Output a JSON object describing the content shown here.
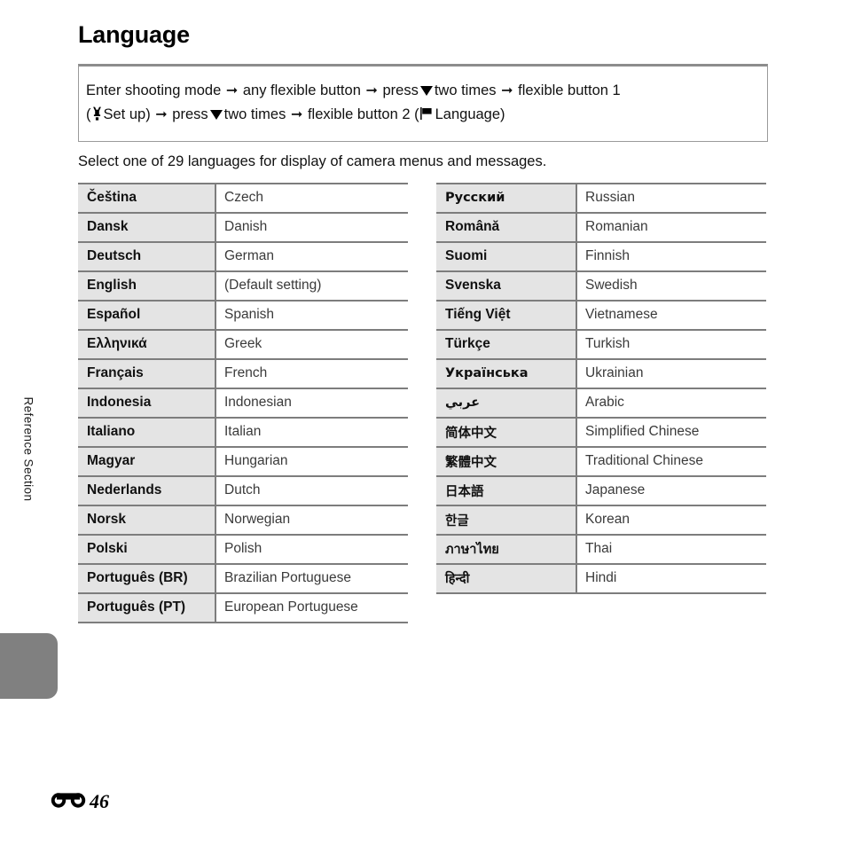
{
  "page": {
    "title": "Language",
    "running_head": "Reference Section",
    "folio_number": "46",
    "folio_icon": "binoculars-reference-icon"
  },
  "instruction_box": {
    "icons": {
      "arrow": "arrow-right-icon",
      "down": "triangle-down-icon",
      "setup": "wrench-icon",
      "language": "flag-icon"
    },
    "segments_line1": {
      "t1": "Enter shooting mode",
      "t2": "any flexible button",
      "t3": "press",
      "t4": "two times",
      "t5": "flexible button 1"
    },
    "segments_line2": {
      "t1": "(",
      "t2": "Set up)",
      "t3": "press",
      "t4": "two times",
      "t5": "flexible button 2 (",
      "t6": "Language)"
    }
  },
  "lead_text": "Select one of 29 languages for display of camera menus and messages.",
  "tables": {
    "left": [
      {
        "native": "Čeština",
        "english": "Czech"
      },
      {
        "native": "Dansk",
        "english": "Danish"
      },
      {
        "native": "Deutsch",
        "english": "German"
      },
      {
        "native": "English",
        "english": "(Default setting)"
      },
      {
        "native": "Español",
        "english": "Spanish"
      },
      {
        "native": "Ελληνικά",
        "english": "Greek"
      },
      {
        "native": "Français",
        "english": "French"
      },
      {
        "native": "Indonesia",
        "english": "Indonesian"
      },
      {
        "native": "Italiano",
        "english": "Italian"
      },
      {
        "native": "Magyar",
        "english": "Hungarian"
      },
      {
        "native": "Nederlands",
        "english": "Dutch"
      },
      {
        "native": "Norsk",
        "english": "Norwegian"
      },
      {
        "native": "Polski",
        "english": "Polish"
      },
      {
        "native": "Português (BR)",
        "english": "Brazilian Portuguese"
      },
      {
        "native": "Português (PT)",
        "english": "European Portuguese"
      }
    ],
    "right": [
      {
        "native": "Русский",
        "english": "Russian"
      },
      {
        "native": "Română",
        "english": "Romanian"
      },
      {
        "native": "Suomi",
        "english": "Finnish"
      },
      {
        "native": "Svenska",
        "english": "Swedish"
      },
      {
        "native": "Tiếng Việt",
        "english": "Vietnamese"
      },
      {
        "native": "Türkçe",
        "english": "Turkish"
      },
      {
        "native": "Українська",
        "english": "Ukrainian"
      },
      {
        "native": "عربي",
        "english": "Arabic"
      },
      {
        "native": "简体中文",
        "english": "Simplified Chinese"
      },
      {
        "native": "繁體中文",
        "english": "Traditional Chinese"
      },
      {
        "native": "日本語",
        "english": "Japanese"
      },
      {
        "native": "한글",
        "english": "Korean"
      },
      {
        "native": "ภาษาไทย",
        "english": "Thai"
      },
      {
        "native": "हिन्दी",
        "english": "Hindi"
      }
    ]
  },
  "colors": {
    "native_cell_bg": "#e4e4e4",
    "rule": "#7d7d7d",
    "tab": "#808080",
    "box_border": "#9a9a9a"
  }
}
